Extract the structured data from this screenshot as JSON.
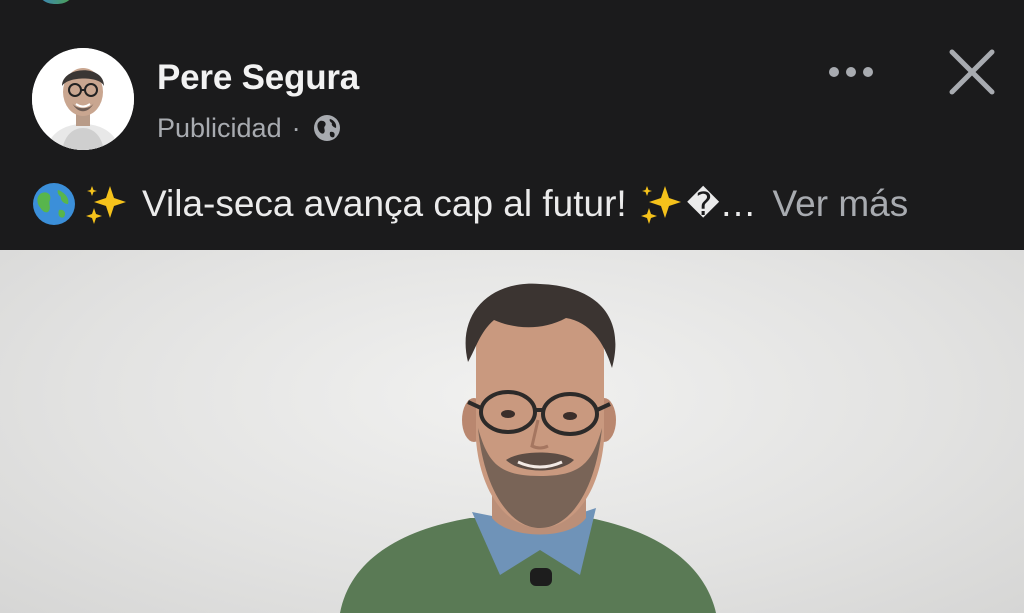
{
  "post": {
    "author_name": "Pere Segura",
    "sponsored_label": "Publicidad",
    "separator": "·",
    "audience_icon": "globe-icon",
    "caption": {
      "text": "Vila-seca avança cap al futur!",
      "truncation": "…",
      "see_more_label": "Ver más"
    },
    "menu_icon": "more-horizontal-icon",
    "close_icon": "close-icon"
  },
  "colors": {
    "background": "#1b1b1c",
    "name": "#f2f2f2",
    "meta": "#a8abb0",
    "photo_background": "#e6e6e5",
    "sweater": "#5a7a55",
    "shirt": "#6f93b8"
  }
}
